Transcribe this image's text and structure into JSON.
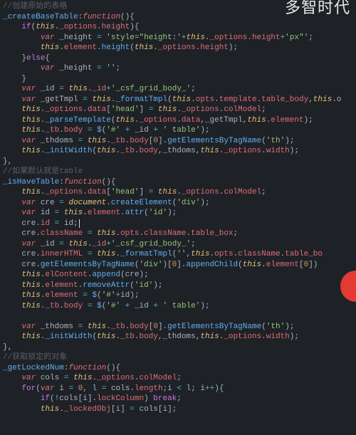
{
  "watermark": "多智时代",
  "lines": [
    {
      "indent": 0,
      "html": "<span class='cm'>//创建原始的表格</span>"
    },
    {
      "indent": 0,
      "html": "<span class='def'>_createBaseTable</span><span class='id'>:</span><span class='fn'>function</span><span class='br'>(){</span>"
    },
    {
      "indent": 1,
      "html": "<span class='kw'>if</span><span class='br'>(</span><span class='th'>this</span><span class='id'>.</span><span class='pr'>_options</span><span class='id'>.</span><span class='pr'>height</span><span class='br'>){</span>"
    },
    {
      "indent": 2,
      "html": "<span class='kw2'>var</span> <span class='id'>_height</span> <span class='op'>=</span> <span class='st'>'style=\"height:'</span><span class='op'>+</span><span class='th'>this</span><span class='id'>.</span><span class='pr'>_options</span><span class='id'>.</span><span class='pr'>height</span><span class='op'>+</span><span class='st'>'px\"'</span><span class='id'>;</span>"
    },
    {
      "indent": 2,
      "html": "<span class='th'>this</span><span class='id'>.</span><span class='pr'>element</span><span class='id'>.</span><span class='mth'>height</span><span class='br'>(</span><span class='th'>this</span><span class='id'>.</span><span class='pr'>_options</span><span class='id'>.</span><span class='pr'>height</span><span class='br'>)</span><span class='id'>;</span>"
    },
    {
      "indent": 1,
      "html": "<span class='br'>}</span><span class='kw'>else</span><span class='br'>{</span>"
    },
    {
      "indent": 2,
      "html": "<span class='kw2'>var</span> <span class='id'>_height</span> <span class='op'>=</span> <span class='st'>''</span><span class='id'>;</span>"
    },
    {
      "indent": 1,
      "html": "<span class='br'>}</span>"
    },
    {
      "indent": 1,
      "html": "<span class='kw2'>var</span> <span class='id'>_id</span> <span class='op'>=</span> <span class='th'>this</span><span class='id'>.</span><span class='pr'>_id</span><span class='op'>+</span><span class='st'>'_csf_grid_body_'</span><span class='id'>;</span>"
    },
    {
      "indent": 1,
      "html": "<span class='kw2'>var</span> <span class='id'>_getTmpl</span> <span class='op'>=</span> <span class='th'>this</span><span class='id'>.</span><span class='mth'>_formatTmpl</span><span class='br'>(</span><span class='th'>this</span><span class='id'>.</span><span class='pr'>opts</span><span class='id'>.</span><span class='pr'>template</span><span class='id'>.</span><span class='pr'>table_body</span><span class='id'>,</span><span class='th'>this</span><span class='id'>.o</span>"
    },
    {
      "indent": 1,
      "html": "<span class='th'>this</span><span class='id'>.</span><span class='pr'>_options</span><span class='id'>.</span><span class='pr'>data</span><span class='br'>[</span><span class='st'>'head'</span><span class='br'>]</span> <span class='op'>=</span> <span class='th'>this</span><span class='id'>.</span><span class='pr'>_options</span><span class='id'>.</span><span class='pr'>colModel</span><span class='id'>;</span>"
    },
    {
      "indent": 1,
      "html": "<span class='th'>this</span><span class='id'>.</span><span class='mth'>_parseTemplate</span><span class='br'>(</span><span class='th'>this</span><span class='id'>.</span><span class='pr'>_options</span><span class='id'>.</span><span class='pr'>data</span><span class='id'>,_getTmpl,</span><span class='th'>this</span><span class='id'>.</span><span class='pr'>element</span><span class='br'>)</span><span class='id'>;</span>"
    },
    {
      "indent": 1,
      "html": "<span class='th'>this</span><span class='id'>.</span><span class='pr'>_tb</span><span class='id'>.</span><span class='pr'>body</span> <span class='op'>=</span> <span class='mth'>$</span><span class='br'>(</span><span class='st'>'#'</span> <span class='op'>+</span> <span class='id'>_id</span> <span class='op'>+</span> <span class='st'>' table'</span><span class='br'>)</span><span class='id'>;</span>"
    },
    {
      "indent": 1,
      "html": "<span class='kw2'>var</span> <span class='id'>_thdoms</span> <span class='op'>=</span> <span class='th'>this</span><span class='id'>.</span><span class='pr'>_tb</span><span class='id'>.</span><span class='pr'>body</span><span class='br'>[</span><span class='nm'>0</span><span class='br'>]</span><span class='id'>.</span><span class='mth'>getElementsByTagName</span><span class='br'>(</span><span class='st'>'th'</span><span class='br'>)</span><span class='id'>;</span>"
    },
    {
      "indent": 1,
      "html": "<span class='th'>this</span><span class='id'>.</span><span class='mth'>_initWidth</span><span class='br'>(</span><span class='th'>this</span><span class='id'>.</span><span class='pr'>_tb</span><span class='id'>.</span><span class='pr'>body</span><span class='id'>,_thdoms,</span><span class='th'>this</span><span class='id'>.</span><span class='pr'>_options</span><span class='id'>.</span><span class='pr'>width</span><span class='br'>)</span><span class='id'>;</span>"
    },
    {
      "indent": 0,
      "html": "<span class='br'>},</span>"
    },
    {
      "indent": 0,
      "html": "<span class='cm'>//如果默认就是table</span>"
    },
    {
      "indent": 0,
      "html": "<span class='def'>_isHaveTable</span><span class='id'>:</span><span class='fn'>function</span><span class='br'>(){</span>"
    },
    {
      "indent": 1,
      "html": "<span class='th'>this</span><span class='id'>.</span><span class='pr'>_options</span><span class='id'>.</span><span class='pr'>data</span><span class='br'>[</span><span class='st'>'head'</span><span class='br'>]</span> <span class='op'>=</span> <span class='th'>this</span><span class='id'>.</span><span class='pr'>_options</span><span class='id'>.</span><span class='pr'>colModel</span><span class='id'>;</span>"
    },
    {
      "indent": 1,
      "html": "<span class='kw2'>var</span> <span class='id'>cre</span> <span class='op'>=</span> <span class='th'>document</span><span class='id'>.</span><span class='mth'>createElement</span><span class='br'>(</span><span class='st'>'div'</span><span class='br'>)</span><span class='id'>;</span>"
    },
    {
      "indent": 1,
      "html": "<span class='kw2'>var</span> <span class='id'>id</span> <span class='op'>=</span> <span class='th'>this</span><span class='id'>.</span><span class='pr'>element</span><span class='id'>.</span><span class='mth'>attr</span><span class='br'>(</span><span class='st'>'id'</span><span class='br'>)</span><span class='id'>;</span>"
    },
    {
      "indent": 1,
      "html": "<span class='id'>cre.</span><span class='pr'>id</span> <span class='op'>=</span> <span class='id'>id;</span><span class='cursor'></span>"
    },
    {
      "indent": 1,
      "html": "<span class='id'>cre.</span><span class='pr'>className</span> <span class='op'>=</span> <span class='th'>this</span><span class='id'>.</span><span class='pr'>opts</span><span class='id'>.</span><span class='pr'>className</span><span class='id'>.</span><span class='pr'>table_box</span><span class='id'>;</span>"
    },
    {
      "indent": 1,
      "html": "<span class='kw2'>var</span> <span class='id'>_id</span> <span class='op'>=</span> <span class='th'>this</span><span class='id'>.</span><span class='pr'>_id</span><span class='op'>+</span><span class='st'>'_csf_grid_body_'</span><span class='id'>;</span>"
    },
    {
      "indent": 1,
      "html": "<span class='id'>cre.</span><span class='pr'>innerHTML</span> <span class='op'>=</span> <span class='th'>this</span><span class='id'>.</span><span class='mth'>_formatTmpl</span><span class='br'>(</span><span class='st'>''</span><span class='id'>,</span><span class='th'>this</span><span class='id'>.</span><span class='pr'>opts</span><span class='id'>.</span><span class='pr'>className</span><span class='id'>.</span><span class='pr'>table_bo</span>"
    },
    {
      "indent": 1,
      "html": "<span class='id'>cre.</span><span class='mth'>getElementsByTagName</span><span class='br'>(</span><span class='st'>'div'</span><span class='br'>)[</span><span class='nm'>0</span><span class='br'>]</span><span class='id'>.</span><span class='mth'>appendChild</span><span class='br'>(</span><span class='th'>this</span><span class='id'>.</span><span class='pr'>element</span><span class='br'>[</span><span class='nm'>0</span><span class='br'>])</span>"
    },
    {
      "indent": 1,
      "html": "<span class='th'>this</span><span class='id'>.</span><span class='pr'>elContent</span><span class='id'>.</span><span class='mth'>append</span><span class='br'>(</span><span class='id'>cre</span><span class='br'>)</span><span class='id'>;</span>"
    },
    {
      "indent": 1,
      "html": "<span class='th'>this</span><span class='id'>.</span><span class='pr'>element</span><span class='id'>.</span><span class='mth'>removeAttr</span><span class='br'>(</span><span class='st'>'id'</span><span class='br'>)</span><span class='id'>;</span>"
    },
    {
      "indent": 1,
      "html": "<span class='th'>this</span><span class='id'>.</span><span class='pr'>element</span> <span class='op'>=</span> <span class='mth'>$</span><span class='br'>(</span><span class='st'>'#'</span><span class='op'>+</span><span class='id'>id</span><span class='br'>)</span><span class='id'>;</span>"
    },
    {
      "indent": 1,
      "html": "<span class='th'>this</span><span class='id'>.</span><span class='pr'>_tb</span><span class='id'>.</span><span class='pr'>body</span> <span class='op'>=</span> <span class='mth'>$</span><span class='br'>(</span><span class='st'>'#'</span> <span class='op'>+</span> <span class='id'>_id</span> <span class='op'>+</span> <span class='st'>' table'</span><span class='br'>)</span><span class='id'>;</span>"
    },
    {
      "indent": 1,
      "html": ""
    },
    {
      "indent": 1,
      "html": "<span class='kw2'>var</span> <span class='id'>_thdoms</span> <span class='op'>=</span> <span class='th'>this</span><span class='id'>.</span><span class='pr'>_tb</span><span class='id'>.</span><span class='pr'>body</span><span class='br'>[</span><span class='nm'>0</span><span class='br'>]</span><span class='id'>.</span><span class='mth'>getElementsByTagName</span><span class='br'>(</span><span class='st'>'th'</span><span class='br'>)</span><span class='id'>;</span>"
    },
    {
      "indent": 1,
      "html": "<span class='th'>this</span><span class='id'>.</span><span class='mth'>_initWidth</span><span class='br'>(</span><span class='th'>this</span><span class='id'>.</span><span class='pr'>_tb</span><span class='id'>.</span><span class='pr'>body</span><span class='id'>,_thdoms,</span><span class='th'>this</span><span class='id'>.</span><span class='pr'>_options</span><span class='id'>.</span><span class='pr'>width</span><span class='br'>)</span><span class='id'>;</span>"
    },
    {
      "indent": 0,
      "html": "<span class='br'>},</span>"
    },
    {
      "indent": 0,
      "html": "<span class='cm'>//获取锁定的对象</span>"
    },
    {
      "indent": 0,
      "html": "<span class='def'>_getLockedNum</span><span class='id'>:</span><span class='fn'>function</span><span class='br'>(){</span>"
    },
    {
      "indent": 1,
      "html": "<span class='kw2'>var</span> <span class='id'>cols</span> <span class='op'>=</span> <span class='th'>this</span><span class='id'>.</span><span class='pr'>_options</span><span class='id'>.</span><span class='pr'>colModel</span><span class='id'>;</span>"
    },
    {
      "indent": 1,
      "html": "<span class='kw'>for</span><span class='br'>(</span><span class='kw2'>var</span> <span class='id'>i</span> <span class='op'>=</span> <span class='nm'>0</span><span class='id'>,</span> <span class='id'>l</span> <span class='op'>=</span> <span class='id'>cols.</span><span class='pr'>length</span><span class='id'>;i</span> <span class='op'>&lt;</span> <span class='id'>l; i</span><span class='op'>++</span><span class='br'>){</span>"
    },
    {
      "indent": 2,
      "html": "<span class='kw'>if</span><span class='br'>(</span><span class='op'>!</span><span class='id'>cols[i].</span><span class='pr'>lockColumn</span><span class='br'>)</span> <span class='kw'>break</span><span class='id'>;</span>"
    },
    {
      "indent": 2,
      "html": "<span class='th'>this</span><span class='id'>.</span><span class='pr'>_lockedObj</span><span class='br'>[</span><span class='id'>i</span><span class='br'>]</span> <span class='op'>=</span> <span class='id'>cols[i];</span>"
    }
  ]
}
